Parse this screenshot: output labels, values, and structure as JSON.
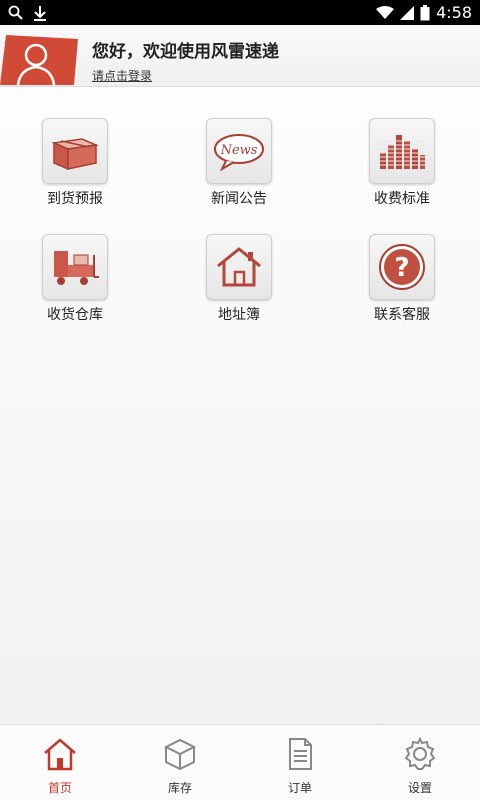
{
  "status_bar": {
    "time": "4:58"
  },
  "header": {
    "greeting": "您好，欢迎使用风雷速递",
    "login_link": "请点击登录"
  },
  "grid": {
    "items": [
      {
        "label": "到货预报",
        "icon": "box-icon"
      },
      {
        "label": "新闻公告",
        "icon": "news-icon"
      },
      {
        "label": "收费标准",
        "icon": "bar-chart-icon"
      },
      {
        "label": "收货仓库",
        "icon": "warehouse-truck-icon"
      },
      {
        "label": "地址簿",
        "icon": "house-icon"
      },
      {
        "label": "联系客服",
        "icon": "help-icon"
      }
    ]
  },
  "bottom_nav": {
    "items": [
      {
        "label": "首页",
        "icon": "home-icon",
        "active": true
      },
      {
        "label": "库存",
        "icon": "inventory-box-icon"
      },
      {
        "label": "订单",
        "icon": "order-document-icon"
      },
      {
        "label": "设置",
        "icon": "gear-icon"
      }
    ]
  },
  "colors": {
    "accent": "#c0392b",
    "icon_red": "#b5473a"
  }
}
